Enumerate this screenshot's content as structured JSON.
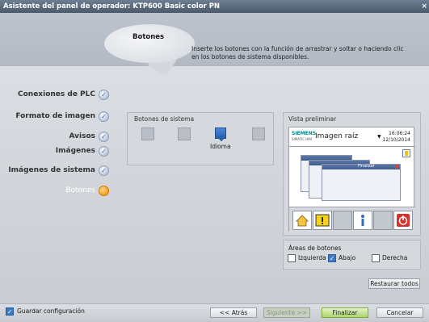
{
  "window": {
    "title": "Asistente del panel de operador: KTP600 Basic color PN"
  },
  "header": {
    "title": "Botones",
    "description": "Inserte los botones con la función de arrastrar y soltar o haciendo clic en los botones de sistema disponibles."
  },
  "nav": {
    "items": [
      {
        "label": "Conexiones de PLC",
        "state": "done"
      },
      {
        "label": "Formato de imagen",
        "state": "done"
      },
      {
        "label": "Avisos",
        "state": "done"
      },
      {
        "label": "Imágenes",
        "state": "done"
      },
      {
        "label": "Imágenes de sistema",
        "state": "done"
      },
      {
        "label": "Botones",
        "state": "active"
      }
    ]
  },
  "system_buttons": {
    "title": "Botones de sistema",
    "items": [
      "",
      "",
      "Idioma",
      ""
    ]
  },
  "preview": {
    "title": "Vista preliminar",
    "brand": "SIEMENS",
    "brand_sub": "SIMATIC HMI",
    "screen_name": "Imagen raíz",
    "time": "16:06:24",
    "date": "12/10/2014",
    "window_bar_label": "Finalizar",
    "buttons": [
      "home-icon",
      "warning-icon",
      "",
      "info-icon",
      "",
      "power-icon"
    ]
  },
  "areas": {
    "title": "Áreas de botones",
    "left": {
      "label": "Izquierda",
      "checked": false
    },
    "bottom": {
      "label": "Abajo",
      "checked": true
    },
    "right": {
      "label": "Derecha",
      "checked": false
    },
    "reset_label": "Restaurar todos"
  },
  "footer": {
    "save_label": "Guardar configuración",
    "save_checked": true,
    "back_label": "<< Atrás",
    "next_label": "Siguiente >>",
    "finish_label": "Finalizar",
    "cancel_label": "Cancelar"
  },
  "colors": {
    "active_step": "#f08a00",
    "done_step": "#9eb2cc",
    "title_bar": "#4a5a6c",
    "finish_button": "#a9d46b"
  }
}
